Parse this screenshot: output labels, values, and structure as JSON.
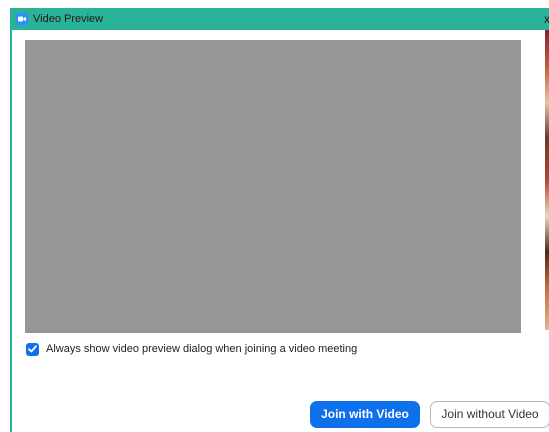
{
  "window": {
    "title": "Video Preview",
    "close_glyph": "x"
  },
  "icons": {
    "app": "zoom-camera-icon",
    "check": "checkmark-icon"
  },
  "preview": {
    "checkbox_label": "Always show video preview dialog when joining a video meeting",
    "checkbox_checked": true
  },
  "buttons": {
    "join_with_video": "Join with Video",
    "join_without_video": "Join without Video"
  },
  "colors": {
    "titlebar": "#2bb39a",
    "accent": "#0e71eb",
    "video_placeholder": "#969696"
  }
}
